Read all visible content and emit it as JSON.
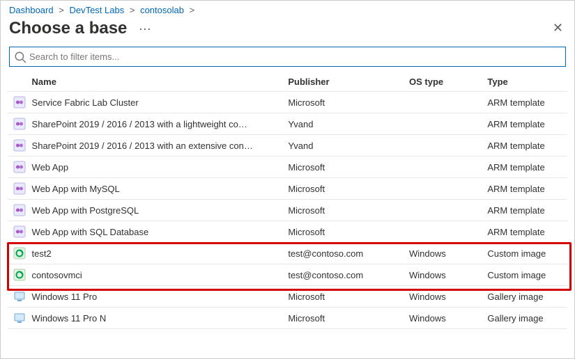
{
  "breadcrumb": {
    "items": [
      "Dashboard",
      "DevTest Labs",
      "contosolab"
    ],
    "sep": ">"
  },
  "header": {
    "title": "Choose a base",
    "more": "⋯",
    "close": "✕"
  },
  "search": {
    "placeholder": "Search to filter items..."
  },
  "columns": {
    "name": "Name",
    "publisher": "Publisher",
    "os": "OS type",
    "type": "Type"
  },
  "rows": [
    {
      "icon": "azure",
      "name": "Service Fabric Lab Cluster",
      "publisher": "Microsoft",
      "os": "",
      "type": "ARM template"
    },
    {
      "icon": "azure",
      "name": "SharePoint 2019 / 2016 / 2013 with a lightweight co…",
      "publisher": "Yvand",
      "os": "",
      "type": "ARM template"
    },
    {
      "icon": "azure",
      "name": "SharePoint 2019 / 2016 / 2013 with an extensive con…",
      "publisher": "Yvand",
      "os": "",
      "type": "ARM template"
    },
    {
      "icon": "azure",
      "name": "Web App",
      "publisher": "Microsoft",
      "os": "",
      "type": "ARM template"
    },
    {
      "icon": "azure",
      "name": "Web App with MySQL",
      "publisher": "Microsoft",
      "os": "",
      "type": "ARM template"
    },
    {
      "icon": "azure",
      "name": "Web App with PostgreSQL",
      "publisher": "Microsoft",
      "os": "",
      "type": "ARM template"
    },
    {
      "icon": "azure",
      "name": "Web App with SQL Database",
      "publisher": "Microsoft",
      "os": "",
      "type": "ARM template"
    },
    {
      "icon": "custom",
      "name": "test2",
      "publisher": "test@contoso.com",
      "os": "Windows",
      "type": "Custom image"
    },
    {
      "icon": "custom",
      "name": "contosovmci",
      "publisher": "test@contoso.com",
      "os": "Windows",
      "type": "Custom image"
    },
    {
      "icon": "vm",
      "name": "Windows 11 Pro",
      "publisher": "Microsoft",
      "os": "Windows",
      "type": "Gallery image"
    },
    {
      "icon": "vm",
      "name": "Windows 11 Pro N",
      "publisher": "Microsoft",
      "os": "Windows",
      "type": "Gallery image"
    }
  ],
  "highlight": {
    "startRow": 7,
    "endRow": 8
  }
}
